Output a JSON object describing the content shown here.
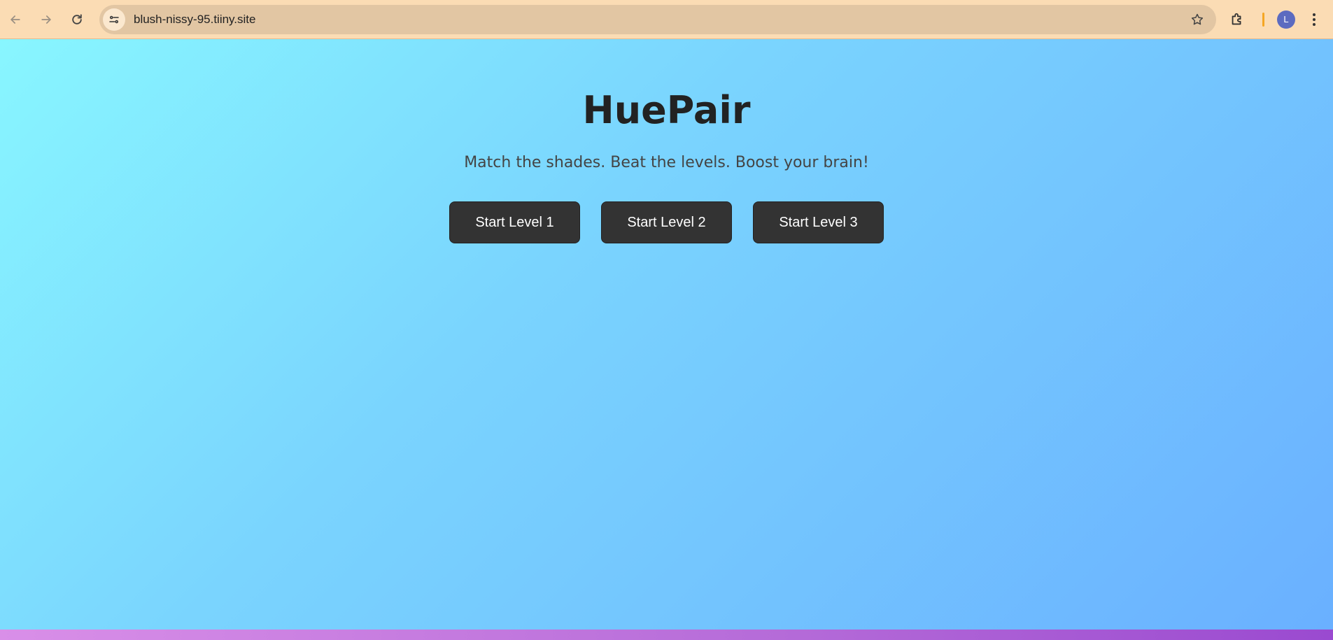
{
  "browser": {
    "url": "blush-nissy-95.tiiny.site",
    "profile_initial": "L",
    "icons": {
      "back": "arrow-left-icon",
      "forward": "arrow-right-icon",
      "reload": "reload-icon",
      "site_info": "tune-icon",
      "bookmark": "star-icon",
      "extensions": "puzzle-icon",
      "menu": "kebab-menu-icon"
    }
  },
  "app": {
    "title": "HuePair",
    "tagline": "Match the shades. Beat the levels. Boost your brain!",
    "levels": [
      {
        "label": "Start Level 1"
      },
      {
        "label": "Start Level 2"
      },
      {
        "label": "Start Level 3"
      }
    ]
  },
  "colors": {
    "button_bg": "#333333",
    "button_text": "#ffffff",
    "title_text": "#222222",
    "gradient_start": "#88f6ff",
    "gradient_end": "#6ab0ff",
    "toolbar_bg": "#fbdcb4",
    "avatar_bg": "#5c6bc0"
  }
}
